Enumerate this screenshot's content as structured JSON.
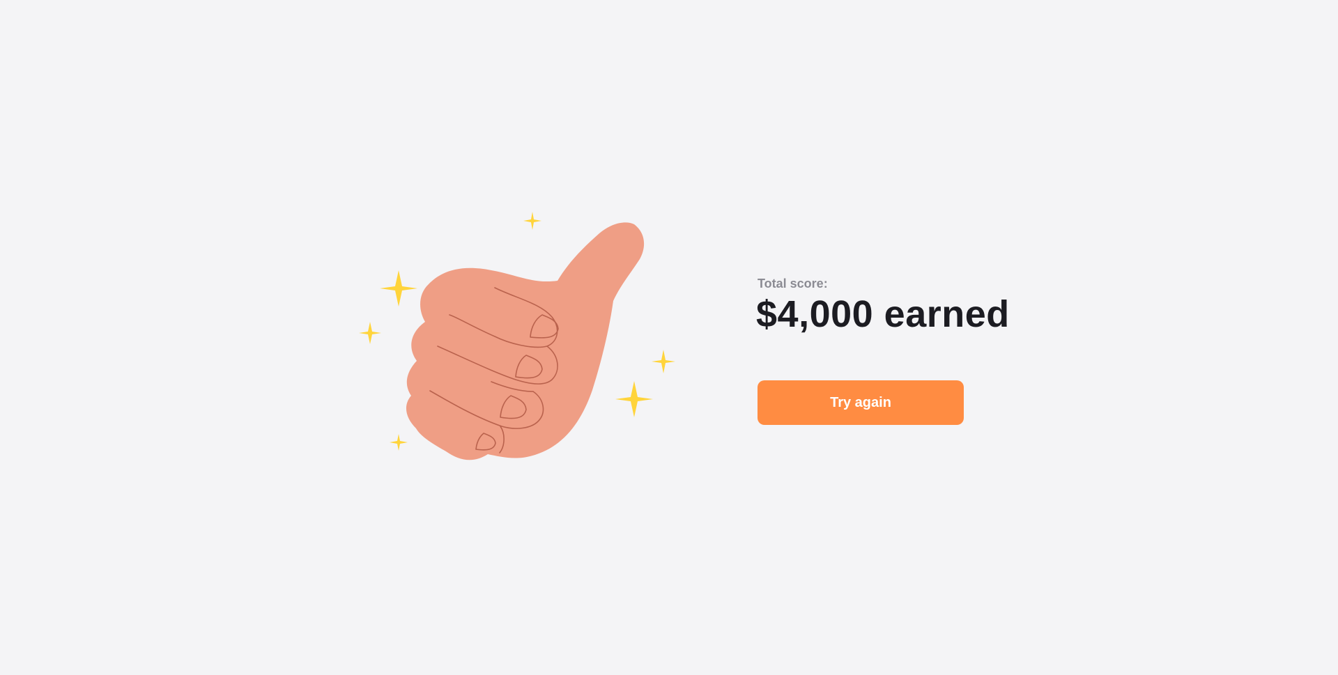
{
  "result": {
    "score_label": "Total score:",
    "score_value": "$4,000 earned",
    "action_label": "Try again"
  },
  "illustration": {
    "icon": "thumbs-up-icon",
    "decorations": "sparkle-icon"
  },
  "colors": {
    "background": "#f4f4f6",
    "accent": "#ff8c42",
    "hand": "#ef9e85",
    "hand_outline": "#b9624d",
    "sparkle": "#ffd43b",
    "label": "#8b8b93",
    "heading": "#1c1c22"
  }
}
